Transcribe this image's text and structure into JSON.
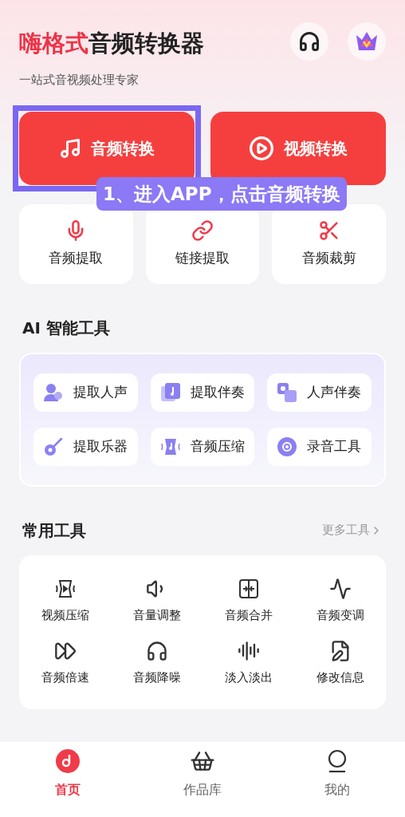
{
  "header": {
    "brand": "嗨格式",
    "title": "音频转换器",
    "subtitle": "一站式音视频处理专家"
  },
  "main_actions": [
    {
      "label": "音频转换",
      "highlighted": true
    },
    {
      "label": "视频转换",
      "highlighted": false
    }
  ],
  "tutorial_callout": "1、进入APP，点击音频转换",
  "quick_tools": [
    {
      "label": "音频提取"
    },
    {
      "label": "链接提取"
    },
    {
      "label": "音频裁剪"
    }
  ],
  "ai_tools": {
    "title": "AI 智能工具",
    "items": [
      {
        "label": "提取人声"
      },
      {
        "label": "提取伴奏"
      },
      {
        "label": "人声伴奏"
      },
      {
        "label": "提取乐器"
      },
      {
        "label": "音频压缩"
      },
      {
        "label": "录音工具"
      }
    ]
  },
  "common_tools": {
    "title": "常用工具",
    "more": "更多工具",
    "items": [
      {
        "label": "视频压缩"
      },
      {
        "label": "音量调整"
      },
      {
        "label": "音频合并"
      },
      {
        "label": "音频变调"
      },
      {
        "label": "音频倍速"
      },
      {
        "label": "音频降噪"
      },
      {
        "label": "淡入淡出"
      },
      {
        "label": "修改信息"
      }
    ]
  },
  "bottom_nav": [
    {
      "label": "首页",
      "selected": true
    },
    {
      "label": "作品库",
      "selected": false
    },
    {
      "label": "我的",
      "selected": false
    }
  ]
}
